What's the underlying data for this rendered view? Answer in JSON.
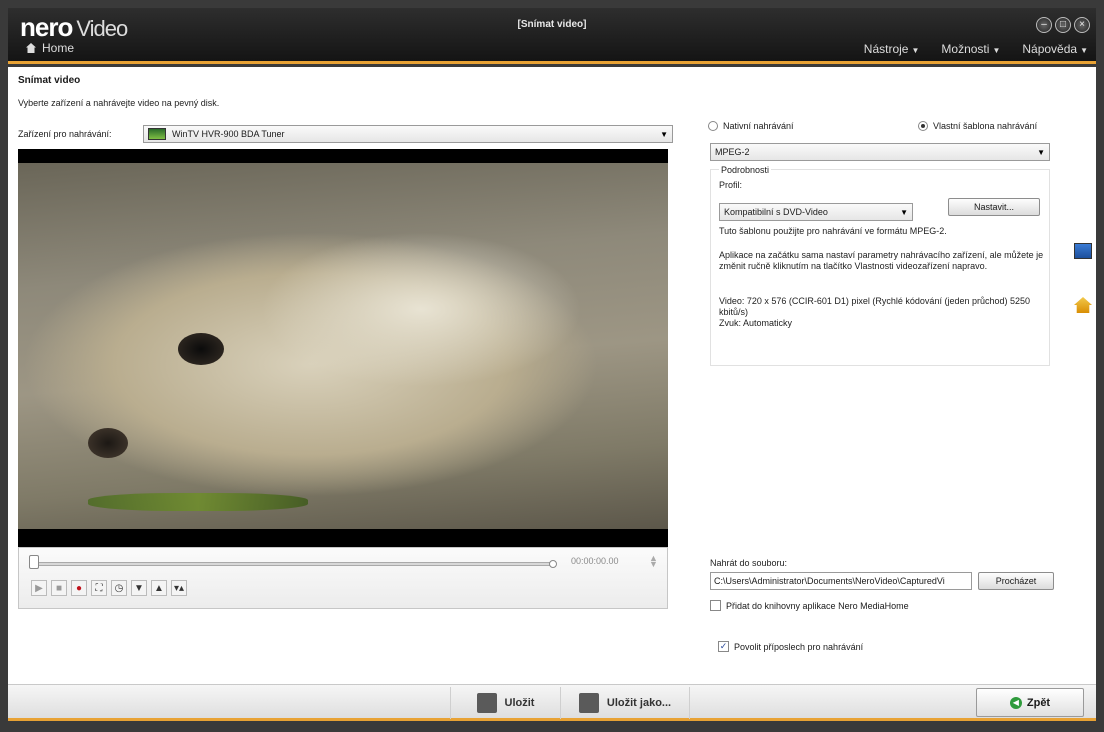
{
  "app": {
    "brand_main": "nero",
    "brand_product": "Video",
    "window_title": "[Snímat video]"
  },
  "nav": {
    "home_label": "Home"
  },
  "menu": {
    "tools": "Nástroje",
    "options": "Možnosti",
    "help": "Nápověda"
  },
  "page": {
    "title": "Snímat video",
    "description": "Vyberte zařízení a nahrávejte video na pevný disk."
  },
  "device": {
    "label": "Zařízení pro nahrávání:",
    "selected": "WinTV HVR-900 BDA Tuner"
  },
  "player": {
    "timecode": "00:00:00.00",
    "position": 0
  },
  "recording": {
    "native_label": "Nativní nahrávání",
    "custom_label": "Vlastní šablona nahrávání",
    "selected_mode": "custom",
    "format": "MPEG-2",
    "details_legend": "Podrobnosti",
    "profile_label": "Profil:",
    "profile": "Kompatibilní s DVD-Video",
    "settings_button": "Nastavit...",
    "info_line": "Tuto šablonu použijte pro nahrávání ve formátu MPEG-2.",
    "info_para": "Aplikace na začátku sama nastaví parametry nahrávacího zařízení, ale můžete je změnit ručně kliknutím na tlačítko Vlastnosti videozařízení napravo.",
    "video_info": "Video: 720 x 576 (CCIR-601 D1) pixel (Rychlé kódování (jeden průchod) 5250 kbitů/s)",
    "audio_info": "Zvuk: Automaticky"
  },
  "output": {
    "label": "Nahrát do souboru:",
    "path": "C:\\Users\\Administrator\\Documents\\NeroVideo\\CapturedVi",
    "browse_button": "Procházet",
    "add_library_label": "Přidat do knihovny aplikace Nero MediaHome",
    "add_library_checked": false,
    "monitor_label": "Povolit příposlech pro nahrávání",
    "monitor_checked": true
  },
  "bottom": {
    "save": "Uložit",
    "save_as": "Uložit jako...",
    "back": "Zpět"
  }
}
